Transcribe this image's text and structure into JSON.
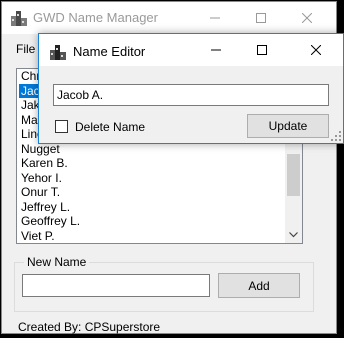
{
  "main_window": {
    "title": "GWD Name Manager",
    "menu_label": "File",
    "list_items": [
      "Chris",
      "Jacob A.",
      "Jake",
      "Mac",
      "Linda",
      "Nugget",
      "Karen B.",
      "Yehor I.",
      "Onur T.",
      "Jeffrey L.",
      "Geoffrey L.",
      "Viet P."
    ],
    "list_items_visible_text": [
      "Chri",
      "Jaco",
      "Jak",
      "Mac",
      "Linc",
      "Nugget",
      "Karen B.",
      "Yehor I.",
      "Onur T.",
      "Jeffrey L.",
      "Geoffrey L.",
      "Viet P."
    ],
    "selected_index": 1,
    "new_name_group_label": "New Name",
    "new_name_value": "",
    "add_label": "Add",
    "footer": "Created By: CPSuperstore"
  },
  "dialog": {
    "title": "Name Editor",
    "name_value": "Jacob A.",
    "delete_label": "Delete Name",
    "delete_checked": false,
    "update_label": "Update"
  },
  "colors": {
    "selection": "#0078d7",
    "dialog_border": "#1883d7",
    "inactive_title": "#9a9a9a"
  },
  "icons": [
    "app-icon",
    "minimize-icon",
    "maximize-icon",
    "close-icon",
    "scroll-down-icon",
    "resize-grip-icon"
  ]
}
